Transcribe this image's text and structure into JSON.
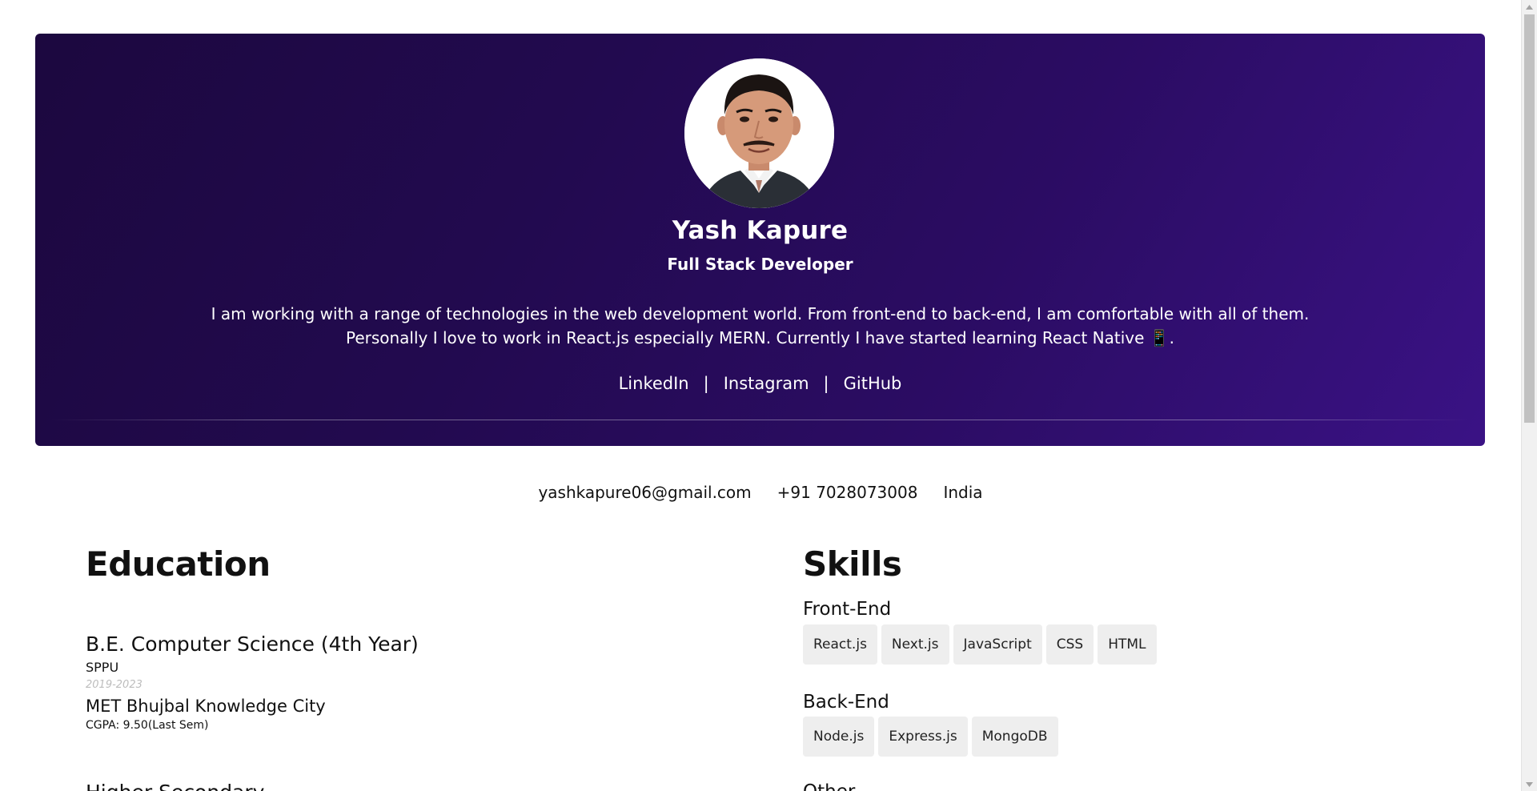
{
  "hero": {
    "name": "Yash Kapure",
    "role": "Full Stack Developer",
    "bio_line1": "I am working with a range of technologies in the web development world. From front-end to back-end, I am comfortable with all of them.",
    "bio_line2": "Personally I love to work in React.js especially MERN. Currently I have started learning React Native 📱.",
    "links": [
      {
        "label": "LinkedIn"
      },
      {
        "label": "Instagram"
      },
      {
        "label": "GitHub"
      }
    ],
    "separator": "|",
    "gradient_colors": [
      "#1c083f",
      "#3a1285"
    ]
  },
  "contact": {
    "email": "yashkapure06@gmail.com",
    "phone": "+91 7028073008",
    "location": "India"
  },
  "education": {
    "title": "Education",
    "entries": [
      {
        "degree": "B.E. Computer Science (4th Year)",
        "university": "SPPU",
        "years": "2019-2023",
        "college": "MET Bhujbal Knowledge City",
        "cgpa": "CGPA: 9.50(Last Sem)"
      }
    ],
    "next_partial": "Higher Secondary"
  },
  "skills": {
    "title": "Skills",
    "front_end": {
      "title": "Front-End",
      "items": [
        "React.js",
        "Next.js",
        "JavaScript",
        "CSS",
        "HTML"
      ]
    },
    "back_end": {
      "title": "Back-End",
      "items": [
        "Node.js",
        "Express.js",
        "MongoDB"
      ]
    },
    "other_partial": "Other"
  }
}
